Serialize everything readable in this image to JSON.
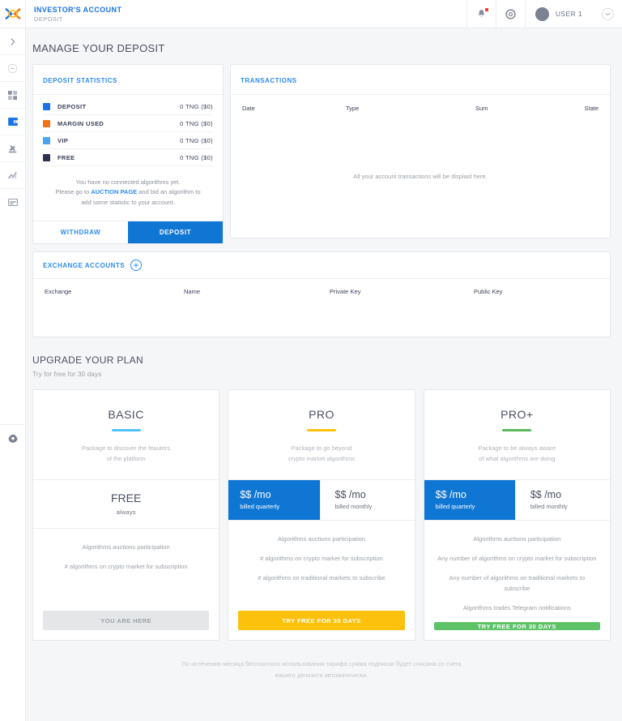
{
  "topbar": {
    "logo_icon": "brand-x-logo",
    "title": "INVESTOR'S ACCOUNT",
    "subtitle": "DEPOSIT",
    "notifications_icon": "bell-icon",
    "support_icon": "lifebuoy-icon",
    "user_name": "USER 1",
    "avatar_icon": "avatar",
    "caret_icon": "chevron-down-icon"
  },
  "sidebar": {
    "items": [
      {
        "name": "expand-rail",
        "icon": "chevron-right-icon"
      },
      {
        "name": "status",
        "icon": "minus-circle-icon"
      },
      {
        "name": "dashboard",
        "icon": "grid-icon"
      },
      {
        "name": "investors-account",
        "icon": "wallet-icon",
        "active": true
      },
      {
        "name": "auction",
        "icon": "gavel-icon"
      },
      {
        "name": "analytics",
        "icon": "chart-icon"
      },
      {
        "name": "terminal",
        "icon": "window-icon"
      }
    ],
    "settings": {
      "name": "settings",
      "icon": "gear-icon"
    }
  },
  "page": {
    "title": "MANAGE YOUR DEPOSIT"
  },
  "deposit_statistics": {
    "header": "DEPOSIT STATISTICS",
    "rows": [
      {
        "label": "DEPOSIT",
        "value": "0 TNG ($0)",
        "color": "#1a73e8"
      },
      {
        "label": "MARGIN USED",
        "value": "0 TNG ($0)",
        "color": "#f47216"
      },
      {
        "label": "VIP",
        "value": "0 TNG ($0)",
        "color": "#4aa3f0"
      },
      {
        "label": "FREE",
        "value": "0 TNG ($0)",
        "color": "#2b3350"
      }
    ],
    "note_line1": "You have no connected algorithms yet.",
    "note_line2_pre": "Please go to ",
    "note_link": "AUCTION PAGE",
    "note_line2_post": " and bid an algorithm to",
    "note_line3": "add some statistic to your account.",
    "withdraw_label": "WITHDRAW",
    "deposit_label": "DEPOSIT"
  },
  "transactions": {
    "header": "TRANSACTIONS",
    "columns": [
      "Date",
      "Type",
      "Sum",
      "State"
    ],
    "empty_message": "All your account transactions will be displaid here."
  },
  "exchange_accounts": {
    "header": "EXCHANGE ACCOUNTS",
    "add_icon": "plus-circle-icon",
    "columns": [
      "Exchange",
      "Name",
      "Private Key",
      "Public Key"
    ]
  },
  "plans_section": {
    "title": "UPGRADE YOUR PLAN",
    "subtitle": "Try for free for 30 days",
    "footer_line1": "По истечению месяца бесплатного использования тарифа сумма подписки будет",
    "footer_line2": "списана со счета вашего депозита автоматически."
  },
  "plans": [
    {
      "name": "BASIC",
      "accent_color": "#4fc3f7",
      "desc_line1": "Package to discover the feauters",
      "desc_line2": "of the platform",
      "price_mode": "single",
      "price_big": "FREE",
      "price_sub": "always",
      "features": [
        "Algorithms auctions participation",
        "# algorithms on crypto market for subscription"
      ],
      "cta_label": "YOU ARE HERE",
      "cta_style": "cta-here"
    },
    {
      "name": "PRO",
      "accent_color": "#ffc107",
      "desc_line1": "Package to go beyond",
      "desc_line2": "crypto market algorithms",
      "price_mode": "toggle",
      "price_quarterly_big": "$$ /mo",
      "price_quarterly_sub": "billed quarterly",
      "price_monthly_big": "$$ /mo",
      "price_monthly_sub": "billed monthly",
      "features": [
        "Algorithms auctions participation",
        "# algorithms on crypto market for subscription",
        "# algorithms on traditional markets to subscribe"
      ],
      "cta_label": "TRY FREE FOR 30 DAYS",
      "cta_style": "cta-amber"
    },
    {
      "name": "PRO+",
      "accent_color": "#5cb85c",
      "desc_line1": "Package to be always aware",
      "desc_line2": "of what algorithms are doing",
      "price_mode": "toggle",
      "price_quarterly_big": "$$ /mo",
      "price_quarterly_sub": "billed quarterly",
      "price_monthly_big": "$$ /mo",
      "price_monthly_sub": "billed monthly",
      "features": [
        "Algorithms auctions participation",
        "Any number of algorithms on crypto market for subscription",
        "Any number of algorithms on traditional markets to subscribe",
        "Algorithms trades Telegram notifications"
      ],
      "cta_label": "TRY FREE FOR 30 DAYS",
      "cta_style": "cta-green"
    }
  ]
}
